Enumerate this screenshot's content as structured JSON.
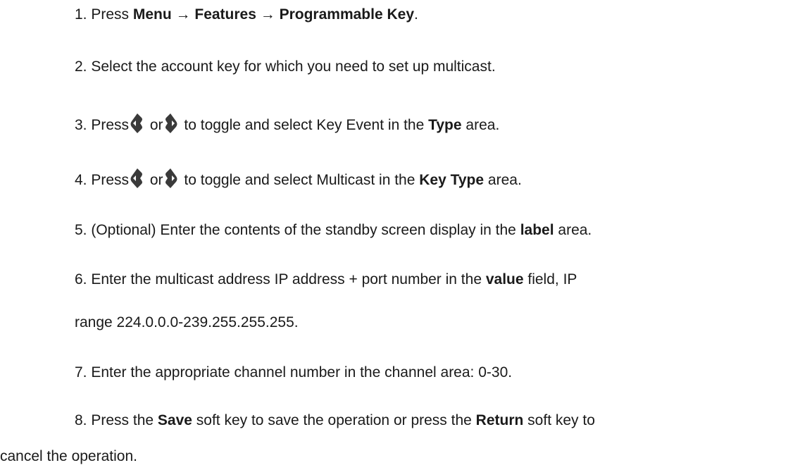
{
  "steps": {
    "s1": {
      "a": "1. Press ",
      "menu": "Menu",
      "arrow1": " → ",
      "features": "Features",
      "arrow2": " → ",
      "prog": "Programmable Key",
      "end": "."
    },
    "s2": {
      "text": "2. Select the account key for which you need to set up multicast."
    },
    "s3": {
      "a": "3. Press",
      "or": " or",
      "mid": " to toggle and select Key Event in the ",
      "bold": "Type",
      "end": " area."
    },
    "s4": {
      "a": "4. Press",
      "or": " or",
      "mid": " to toggle and select Multicast in the ",
      "bold": "Key Type",
      "end": " area."
    },
    "s5": {
      "a": "5. (Optional) Enter the contents of the standby screen display in the ",
      "bold": "label",
      "end": " area."
    },
    "s6": {
      "a": "6. Enter the multicast address IP address + port number in the ",
      "bold": "value",
      "end": " field, IP",
      "cont": "range 224.0.0.0-239.255.255.255."
    },
    "s7": {
      "text": "7. Enter the appropriate channel number in the channel area: 0-30."
    },
    "s8": {
      "a": "8. Press the ",
      "save": "Save",
      "mid": " soft key to save the operation or press the ",
      "ret": "Return",
      "end": " soft key to",
      "cont": "cancel the operation."
    }
  },
  "icons": {
    "left": "left-navigation-key-icon",
    "right": "right-navigation-key-icon",
    "fill": "#3a3a3a"
  }
}
